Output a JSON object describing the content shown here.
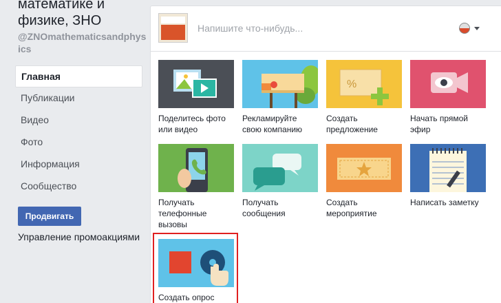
{
  "page": {
    "name": "математике и физике, ЗНО",
    "handle": "@ZNOmathematicsandphysics"
  },
  "nav": {
    "items": [
      {
        "label": "Главная",
        "active": true
      },
      {
        "label": "Публикации"
      },
      {
        "label": "Видео"
      },
      {
        "label": "Фото"
      },
      {
        "label": "Информация"
      },
      {
        "label": "Сообщество"
      }
    ]
  },
  "promote_button": "Продвигать",
  "manage_promotions": "Управление промоакциями",
  "composer": {
    "placeholder": "Напишите что-нибудь..."
  },
  "tiles": [
    {
      "label": "Поделитесь фото или видео",
      "icon": "photo-video-icon",
      "color": "#4b4f56"
    },
    {
      "label": "Рекламируйте свою компанию",
      "icon": "billboard-icon",
      "color": "#5fc2e8"
    },
    {
      "label": "Создать предложение",
      "icon": "coupon-icon",
      "color": "#f5c33b"
    },
    {
      "label": "Начать прямой эфир",
      "icon": "live-video-icon",
      "color": "#e0526e"
    },
    {
      "label": "Получать телефонные вызовы",
      "icon": "phone-call-icon",
      "color": "#6fb24c"
    },
    {
      "label": "Получать сообщения",
      "icon": "messages-icon",
      "color": "#7dd4c8"
    },
    {
      "label": "Создать мероприятие",
      "icon": "event-ticket-icon",
      "color": "#f08a3c"
    },
    {
      "label": "Написать заметку",
      "icon": "note-icon",
      "color": "#3d6fb5"
    },
    {
      "label": "Создать опрос",
      "icon": "poll-icon",
      "color": "#5fc2e8"
    }
  ]
}
